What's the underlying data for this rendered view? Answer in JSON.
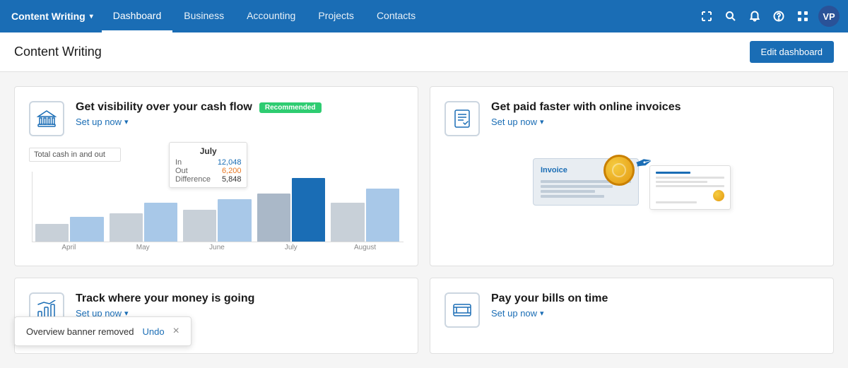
{
  "brand": {
    "name": "Content Writing",
    "caret": "▾"
  },
  "nav": {
    "links": [
      {
        "label": "Dashboard",
        "active": true
      },
      {
        "label": "Business",
        "active": false
      },
      {
        "label": "Accounting",
        "active": false
      },
      {
        "label": "Projects",
        "active": false
      },
      {
        "label": "Contacts",
        "active": false
      }
    ],
    "avatar": "VP"
  },
  "page": {
    "title": "Content Writing",
    "edit_button": "Edit dashboard"
  },
  "cards": [
    {
      "id": "cash-flow",
      "icon": "bank",
      "title": "Get visibility over your cash flow",
      "badge": "Recommended",
      "setup_label": "Set up now",
      "chart": {
        "tooltip_month": "July",
        "in_label": "In",
        "in_value": "12,048",
        "out_label": "Out",
        "out_value": "6,200",
        "diff_label": "Difference",
        "diff_value": "5,848",
        "total_label": "Total cash in and out",
        "x_labels": [
          "April",
          "May",
          "June",
          "July",
          "August"
        ],
        "bars": [
          {
            "month": "April",
            "blue": 35,
            "gray": 25
          },
          {
            "month": "May",
            "blue": 50,
            "gray": 40
          },
          {
            "month": "June",
            "blue": 55,
            "gray": 45
          },
          {
            "month": "July",
            "blue": 90,
            "gray": 70
          },
          {
            "month": "August",
            "blue": 75,
            "gray": 60
          }
        ]
      }
    },
    {
      "id": "online-invoices",
      "icon": "invoice",
      "title": "Get paid faster with online invoices",
      "badge": null,
      "setup_label": "Set up now"
    },
    {
      "id": "track-money",
      "icon": "chart",
      "title": "Track where your money is going",
      "badge": null,
      "setup_label": "Set up now"
    },
    {
      "id": "pay-bills",
      "icon": "bills",
      "title": "Pay your bills on time",
      "badge": null,
      "setup_label": "Set up now"
    }
  ],
  "toast": {
    "message": "Overview banner removed",
    "undo_label": "Undo",
    "close": "×"
  }
}
